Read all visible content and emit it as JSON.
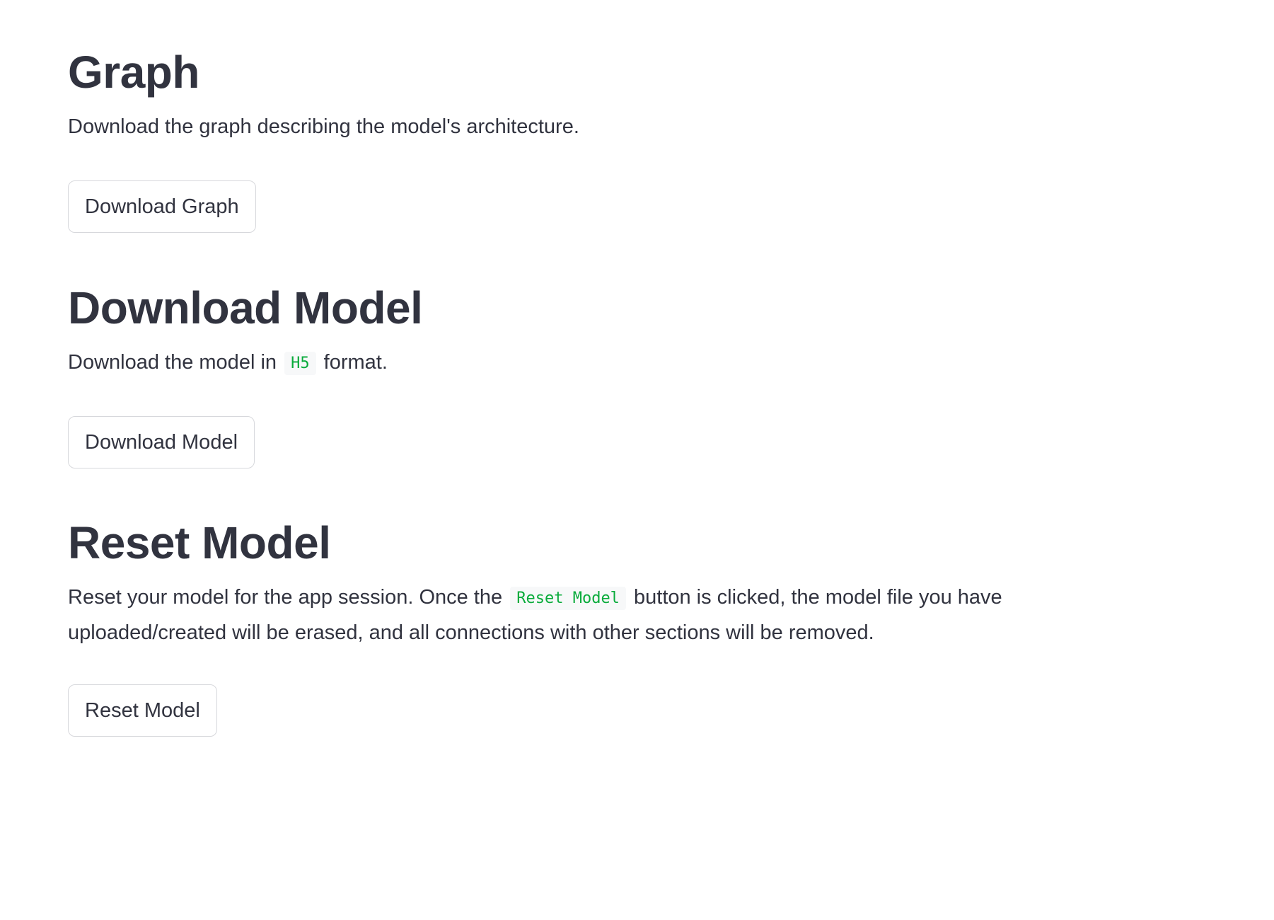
{
  "graph_section": {
    "heading": "Graph",
    "description": "Download the graph describing the model's architecture.",
    "button_label": "Download Graph"
  },
  "download_section": {
    "heading": "Download Model",
    "description_prefix": "Download the model in",
    "format_code": "H5",
    "description_suffix": "format.",
    "button_label": "Download Model"
  },
  "reset_section": {
    "heading": "Reset Model",
    "description_prefix": "Reset your model for the app session. Once the",
    "inline_code": "Reset Model",
    "description_suffix": "button is clicked, the model file you have uploaded/created will be erased, and all connections with other sections will be removed.",
    "button_label": "Reset Model"
  },
  "colors": {
    "text": "#31333f",
    "code_text": "#09ab3b",
    "code_background": "#f7f8f9",
    "button_border": "#d7d8dc"
  }
}
